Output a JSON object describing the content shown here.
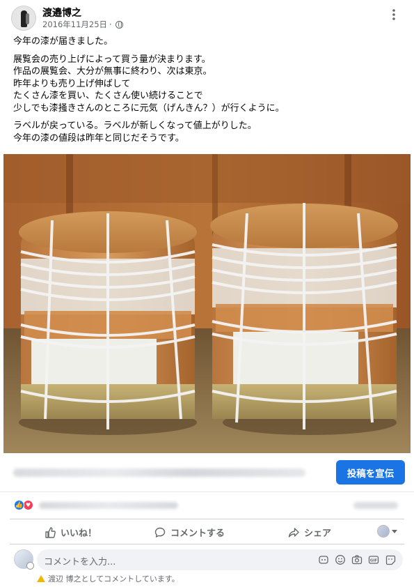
{
  "post": {
    "author": "渡邉博之",
    "date": "2016年11月25日",
    "separator": "·",
    "paragraphs": [
      [
        "今年の漆が届きました。"
      ],
      [
        "展覧会の売り上げによって買う量が決まります。",
        "作品の展覧会、大分が無事に終わり、次は東京。",
        "昨年よりも売り上げ伸ばして",
        "たくさん漆を買い、たくさん使い続けることで",
        "少しでも漆掻きさんのところに元気（げんきん？）が行くように。"
      ],
      [
        "ラベルが戻っている。ラベルが新しくなって値上がりした。",
        "今年の漆の値段は昨年と同じだそうです。"
      ]
    ]
  },
  "promo": {
    "boost_label": "投稿を宣伝"
  },
  "actions": {
    "like_label": "いいね！",
    "comment_label": "コメントする",
    "share_label": "シェア"
  },
  "comment_box": {
    "placeholder": "コメントを入力...",
    "notice": "渡辺 博之としてコメントしています。"
  },
  "colors": {
    "accent": "#1b74e4",
    "like_blue": "#1877f2",
    "love_red": "#f33e58",
    "muted_text": "#65676b"
  },
  "icons": {
    "more": "more-options-icon",
    "privacy": "globe-icon",
    "like": "thumbs-up-icon",
    "comment": "comment-bubble-icon",
    "share": "share-arrow-icon",
    "warning": "warning-icon"
  }
}
